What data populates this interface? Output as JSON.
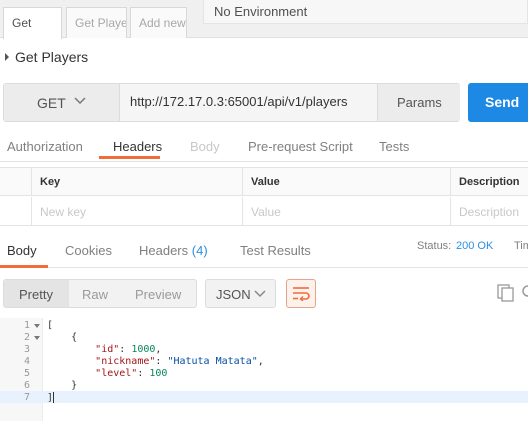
{
  "request_tabs": [
    {
      "label": "Get"
    },
    {
      "label": "Get Players"
    },
    {
      "label": "Add new"
    }
  ],
  "environment": {
    "selected": "No Environment"
  },
  "request_name": "Get Players",
  "url_bar": {
    "method": "GET",
    "url": "http://172.17.0.3:65001/api/v1/players",
    "params_label": "Params",
    "send_label": "Send"
  },
  "request_section_tabs": [
    {
      "label": "Authorization"
    },
    {
      "label": "Headers"
    },
    {
      "label": "Body"
    },
    {
      "label": "Pre-request Script"
    },
    {
      "label": "Tests"
    }
  ],
  "headers_table": {
    "columns": [
      "Key",
      "Value",
      "Description"
    ],
    "placeholders": [
      "New key",
      "Value",
      "Description"
    ]
  },
  "response": {
    "tabs": [
      {
        "label": "Body"
      },
      {
        "label": "Cookies"
      },
      {
        "label": "Headers",
        "count": "(4)"
      },
      {
        "label": "Test Results"
      }
    ],
    "status_label": "Status:",
    "status_value": "200 OK",
    "time_label": "Tim",
    "format_buttons": [
      "Pretty",
      "Raw",
      "Preview"
    ],
    "format_type": "JSON",
    "colors": {
      "accent": "#f26b3a",
      "send": "#1e88e5",
      "status": "#2f8ee0"
    }
  },
  "code": {
    "line_numbers": [
      "1",
      "2",
      "3",
      "4",
      "5",
      "6",
      "7"
    ],
    "lines": [
      {
        "text": "["
      },
      {
        "text": "    {"
      },
      {
        "key": "\"id\"",
        "sep": ": ",
        "val": "1000",
        "end": ",",
        "val_type": "n"
      },
      {
        "key": "\"nickname\"",
        "sep": ": ",
        "val": "\"Hatuta Matata\"",
        "end": ",",
        "val_type": "s"
      },
      {
        "key": "\"level\"",
        "sep": ": ",
        "val": "100",
        "end": "",
        "val_type": "n"
      },
      {
        "text": "    }"
      },
      {
        "text": "]"
      }
    ]
  }
}
